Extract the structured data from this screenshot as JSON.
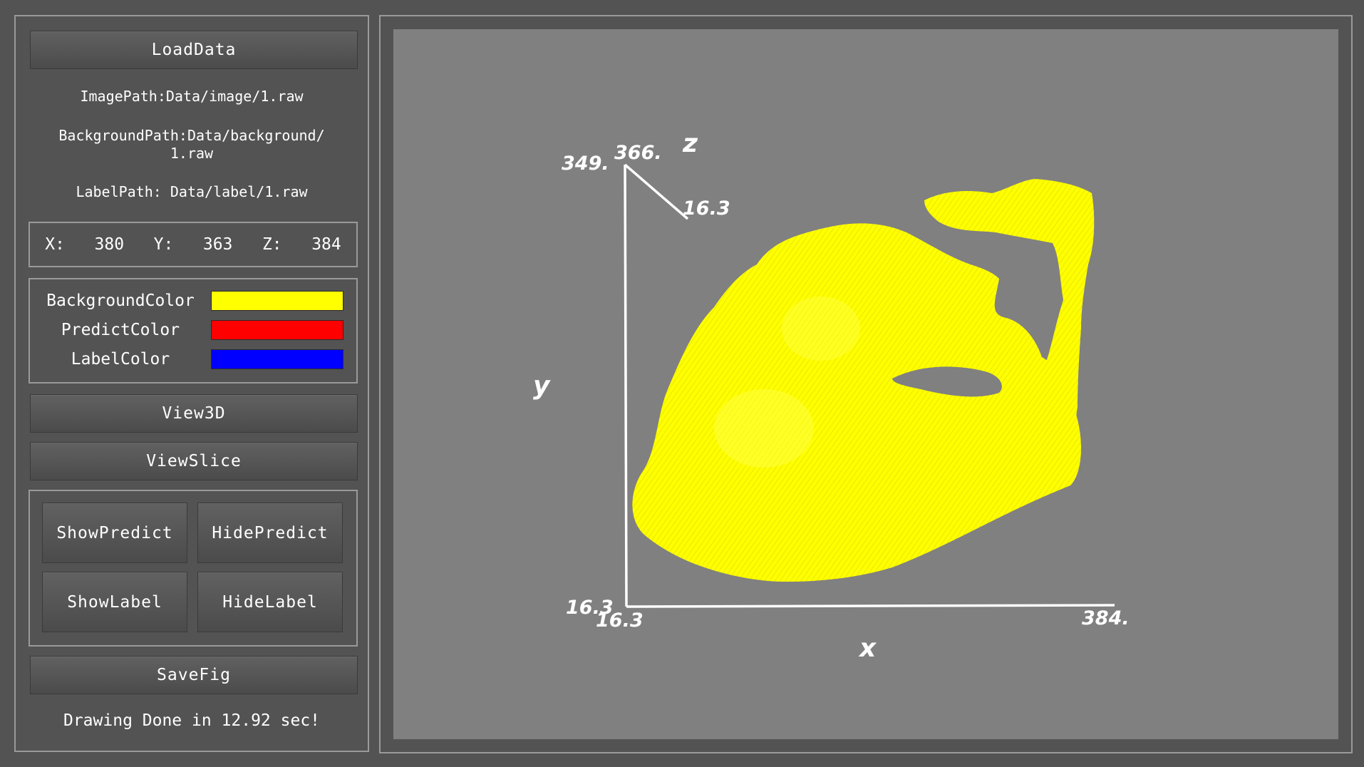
{
  "controls": {
    "load_data_label": "LoadData",
    "image_path": "ImagePath:Data/image/1.raw",
    "background_path_line1": "BackgroundPath:Data/background/",
    "background_path_line2": "1.raw",
    "label_path": "LabelPath: Data/label/1.raw",
    "coords": {
      "x_label": "X:",
      "x_value": "380",
      "y_label": "Y:",
      "y_value": "363",
      "z_label": "Z:",
      "z_value": "384"
    },
    "colors": [
      {
        "name": "BackgroundColor",
        "color": "#ffff00"
      },
      {
        "name": "PredictColor",
        "color": "#ff0000"
      },
      {
        "name": "LabelColor",
        "color": "#0000ff"
      }
    ],
    "view3d_label": "View3D",
    "viewslice_label": "ViewSlice",
    "show_predict_label": "ShowPredict",
    "hide_predict_label": "HidePredict",
    "show_label_label": "ShowLabel",
    "hide_label_label": "HideLabel",
    "savefig_label": "SaveFig",
    "status": "Drawing Done in 12.92 sec!"
  },
  "plot": {
    "background_color": "#808080",
    "volume_color": "#ffff00",
    "axes": {
      "x_name": "x",
      "y_name": "y",
      "z_name": "z",
      "x_min": "16.3",
      "x_max": "384.",
      "y_min": "16.3",
      "y_max": "349.",
      "z_min": "16.3",
      "z_max": "366."
    }
  }
}
